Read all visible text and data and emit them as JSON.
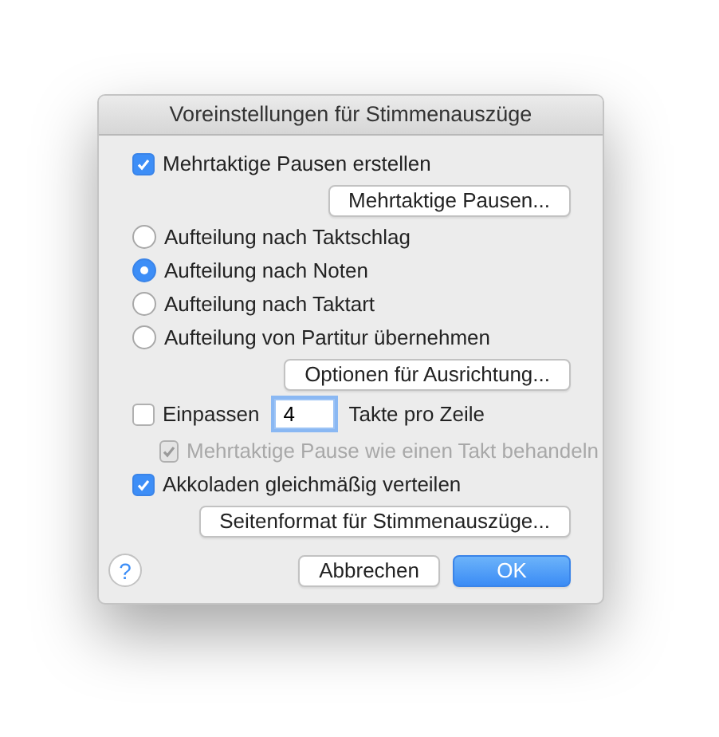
{
  "window": {
    "title": "Voreinstellungen für Stimmenauszüge"
  },
  "items": [
    {
      "kind": "checkbox",
      "label": "Mehrtaktige Pausen erstellen",
      "checked": true,
      "disabled": false,
      "indent": false
    },
    {
      "kind": "button",
      "label": "Mehrtaktige Pausen..."
    },
    {
      "kind": "radio",
      "label": "Aufteilung nach Taktschlag",
      "selected": false
    },
    {
      "kind": "radio",
      "label": "Aufteilung nach Noten",
      "selected": true
    },
    {
      "kind": "radio",
      "label": "Aufteilung nach Taktart",
      "selected": false
    },
    {
      "kind": "radio",
      "label": "Aufteilung von Partitur übernehmen",
      "selected": false
    },
    {
      "kind": "button",
      "label": "Optionen für Ausrichtung..."
    },
    {
      "kind": "fit",
      "label": "Einpassen",
      "checked": false,
      "value": "4",
      "suffix": "Takte pro Zeile"
    },
    {
      "kind": "checkbox",
      "label": "Mehrtaktige Pause wie einen Takt behandeln",
      "checked": true,
      "disabled": true,
      "indent": true
    },
    {
      "kind": "checkbox",
      "label": "Akkoladen gleichmäßig verteilen",
      "checked": true,
      "disabled": false,
      "indent": false
    },
    {
      "kind": "button",
      "label": "Seitenformat für Stimmenauszüge..."
    }
  ],
  "footer": {
    "help": "?",
    "cancel": "Abbrechen",
    "ok": "OK"
  }
}
